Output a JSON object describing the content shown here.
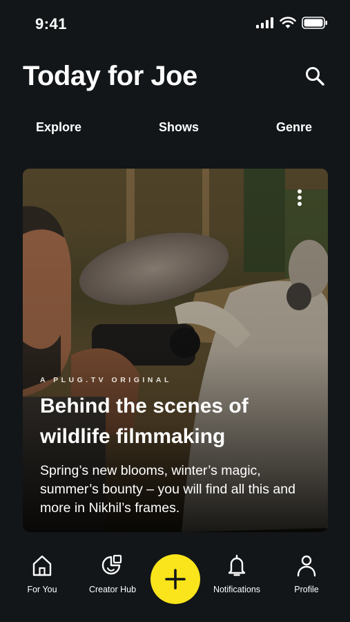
{
  "status_bar": {
    "time": "9:41",
    "icons": [
      "cellular-signal-icon",
      "wifi-icon",
      "battery-icon"
    ]
  },
  "header": {
    "title": "Today for Joe",
    "search_icon": "search-icon"
  },
  "tabs": [
    {
      "label": "Explore"
    },
    {
      "label": "Shows"
    },
    {
      "label": "Genre"
    }
  ],
  "featured_card": {
    "eyebrow": "A PLUG.TV ORIGINAL",
    "headline": "Behind the scenes of wildlife filmmaking",
    "description": "Spring’s new blooms, winter’s magic, summer’s bounty – you will find all this and more in Nikhil’s frames.",
    "more_icon": "more-vertical-icon"
  },
  "bottom_nav": {
    "items": [
      {
        "label": "For You",
        "icon": "home-icon"
      },
      {
        "label": "Creator Hub",
        "icon": "creator-hub-icon"
      },
      {
        "label": "Notifications",
        "icon": "bell-icon"
      },
      {
        "label": "Profile",
        "icon": "profile-icon"
      }
    ],
    "fab_icon": "plus-icon"
  },
  "colors": {
    "background": "#121619",
    "accent": "#fae41b",
    "text": "#ffffff"
  }
}
